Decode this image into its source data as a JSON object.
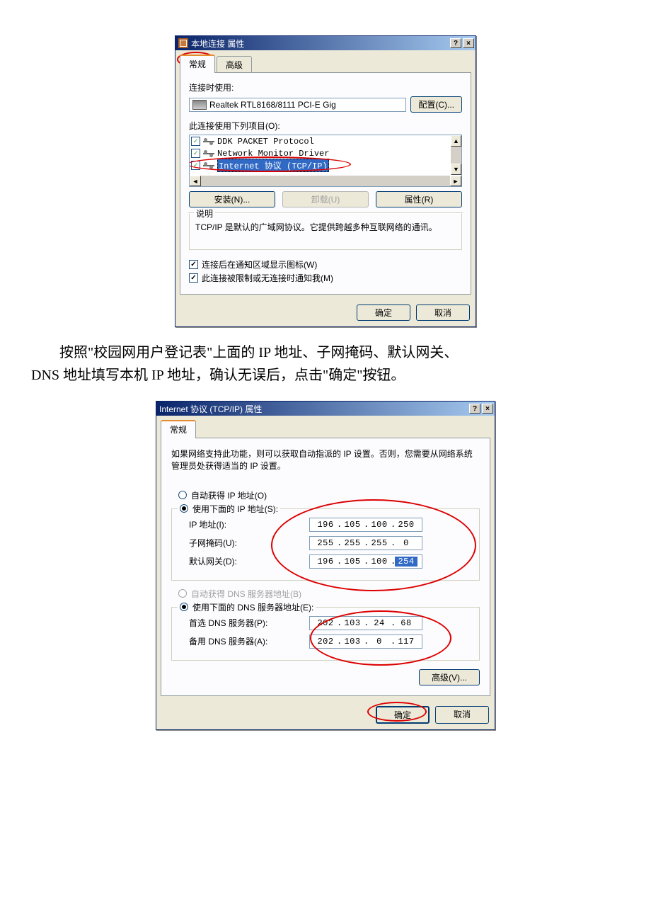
{
  "dialog1": {
    "title": "本地连接 属性",
    "tabs": {
      "general": "常规",
      "advanced": "高级"
    },
    "connect_using_label": "连接时使用:",
    "adapter_name": "Realtek RTL8168/8111 PCI-E Gig",
    "configure_btn": "配置(C)...",
    "items_label": "此连接使用下列项目(O):",
    "items": [
      {
        "checked": true,
        "label": "DDK PACKET Protocol",
        "selected": false
      },
      {
        "checked": true,
        "label": "Network Monitor Driver",
        "selected": false
      },
      {
        "checked": true,
        "label": "Internet 协议 (TCP/IP)",
        "selected": true
      }
    ],
    "install_btn": "安装(N)...",
    "uninstall_btn": "卸载(U)",
    "properties_btn": "属性(R)",
    "desc_legend": "说明",
    "desc_text": "TCP/IP 是默认的广域网协议。它提供跨越多种互联网络的通讯。",
    "show_icon": "连接后在通知区域显示图标(W)",
    "notify_me": "此连接被限制或无连接时通知我(M)",
    "ok": "确定",
    "cancel": "取消"
  },
  "midtext_line1": "按照\"校园网用户登记表\"上面的 IP 地址、子网掩码、默认网关、",
  "midtext_line2": "DNS 地址填写本机 IP 地址，确认无误后，点击\"确定\"按钮。",
  "dialog2": {
    "title": "Internet 协议 (TCP/IP) 属性",
    "tab_general": "常规",
    "desc": "如果网络支持此功能，则可以获取自动指派的 IP 设置。否则，您需要从网络系统管理员处获得适当的 IP 设置。",
    "radio_auto_ip": "自动获得 IP 地址(O)",
    "radio_use_ip": "使用下面的 IP 地址(S):",
    "ip_label": "IP 地址(I):",
    "ip_value": [
      "196",
      "105",
      "100",
      "250"
    ],
    "subnet_label": "子网掩码(U):",
    "subnet_value": [
      "255",
      "255",
      "255",
      "0"
    ],
    "gateway_label": "默认网关(D):",
    "gateway_value": [
      "196",
      "105",
      "100",
      "254"
    ],
    "radio_auto_dns": "自动获得 DNS 服务器地址(B)",
    "radio_use_dns": "使用下面的 DNS 服务器地址(E):",
    "pref_dns_label": "首选 DNS 服务器(P):",
    "pref_dns_value": [
      "202",
      "103",
      "24",
      "68"
    ],
    "alt_dns_label": "备用 DNS 服务器(A):",
    "alt_dns_value": [
      "202",
      "103",
      "0",
      "117"
    ],
    "advanced_btn": "高级(V)...",
    "ok": "确定",
    "cancel": "取消"
  }
}
